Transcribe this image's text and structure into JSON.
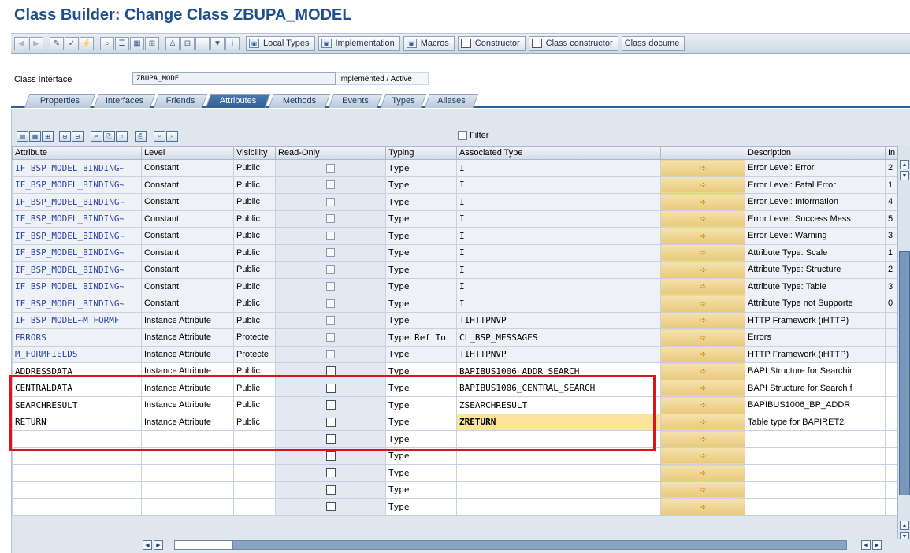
{
  "title": "Class Builder: Change Class ZBUPA_MODEL",
  "toolbar": {
    "buttons": [
      {
        "label": "Local Types",
        "icon": "local-types-icon"
      },
      {
        "label": "Implementation",
        "icon": "implementation-icon"
      },
      {
        "label": "Macros",
        "icon": "macros-icon"
      },
      {
        "label": "Constructor",
        "icon": "page-icon"
      },
      {
        "label": "Class constructor",
        "icon": "page-icon"
      },
      {
        "label": "Class docume",
        "icon": ""
      }
    ]
  },
  "interface": {
    "label": "Class Interface",
    "value": "ZBUPA_MODEL",
    "status": "Implemented / Active"
  },
  "tabs": [
    "Properties",
    "Interfaces",
    "Friends",
    "Attributes",
    "Methods",
    "Events",
    "Types",
    "Aliases"
  ],
  "active_tab": "Attributes",
  "filter_label": "Filter",
  "columns": [
    "Attribute",
    "Level",
    "Visibility",
    "Read-Only",
    "Typing",
    "Associated Type",
    "",
    "Description",
    "In"
  ],
  "rows": [
    {
      "attribute": "IF_BSP_MODEL_BINDING~",
      "level": "Constant",
      "visibility": "Public",
      "typing": "Type",
      "assoc": "I",
      "description": "Error Level: Error",
      "initial": "2"
    },
    {
      "attribute": "IF_BSP_MODEL_BINDING~",
      "level": "Constant",
      "visibility": "Public",
      "typing": "Type",
      "assoc": "I",
      "description": "Error Level: Fatal Error",
      "initial": "1"
    },
    {
      "attribute": "IF_BSP_MODEL_BINDING~",
      "level": "Constant",
      "visibility": "Public",
      "typing": "Type",
      "assoc": "I",
      "description": "Error Level: Information",
      "initial": "4"
    },
    {
      "attribute": "IF_BSP_MODEL_BINDING~",
      "level": "Constant",
      "visibility": "Public",
      "typing": "Type",
      "assoc": "I",
      "description": "Error Level: Success Mess",
      "initial": "5"
    },
    {
      "attribute": "IF_BSP_MODEL_BINDING~",
      "level": "Constant",
      "visibility": "Public",
      "typing": "Type",
      "assoc": "I",
      "description": "Error Level: Warning",
      "initial": "3"
    },
    {
      "attribute": "IF_BSP_MODEL_BINDING~",
      "level": "Constant",
      "visibility": "Public",
      "typing": "Type",
      "assoc": "I",
      "description": "Attribute Type: Scale",
      "initial": "1"
    },
    {
      "attribute": "IF_BSP_MODEL_BINDING~",
      "level": "Constant",
      "visibility": "Public",
      "typing": "Type",
      "assoc": "I",
      "description": "Attribute Type: Structure",
      "initial": "2"
    },
    {
      "attribute": "IF_BSP_MODEL_BINDING~",
      "level": "Constant",
      "visibility": "Public",
      "typing": "Type",
      "assoc": "I",
      "description": "Attribute Type: Table",
      "initial": "3"
    },
    {
      "attribute": "IF_BSP_MODEL_BINDING~",
      "level": "Constant",
      "visibility": "Public",
      "typing": "Type",
      "assoc": "I",
      "description": "Attribute Type not Supporte",
      "initial": "0"
    },
    {
      "attribute": "IF_BSP_MODEL~M_FORMF",
      "level": "Instance Attribute",
      "visibility": "Public",
      "typing": "Type",
      "assoc": "TIHTTPNVP",
      "description": "HTTP Framework (iHTTP)",
      "initial": ""
    },
    {
      "attribute": "ERRORS",
      "level": "Instance Attribute",
      "visibility": "Protecte",
      "typing": "Type Ref To",
      "assoc": "CL_BSP_MESSAGES",
      "description": "Errors",
      "initial": ""
    },
    {
      "attribute": "M_FORMFIELDS",
      "level": "Instance Attribute",
      "visibility": "Protecte",
      "typing": "Type",
      "assoc": "TIHTTPNVP",
      "description": "HTTP Framework (iHTTP)",
      "initial": ""
    },
    {
      "attribute": "ADDRESSDATA",
      "level": "Instance Attribute",
      "visibility": "Public",
      "typing": "Type",
      "assoc": "BAPIBUS1006_ADDR_SEARCH",
      "description": "BAPI Structure for Searchir",
      "initial": ""
    },
    {
      "attribute": "CENTRALDATA",
      "level": "Instance Attribute",
      "visibility": "Public",
      "typing": "Type",
      "assoc": "BAPIBUS1006_CENTRAL_SEARCH",
      "description": "BAPI Structure for Search f",
      "initial": ""
    },
    {
      "attribute": "SEARCHRESULT",
      "level": "Instance Attribute",
      "visibility": "Public",
      "typing": "Type",
      "assoc": "ZSEARCHRESULT",
      "description": "BAPIBUS1006_BP_ADDR",
      "initial": ""
    },
    {
      "attribute": "RETURN",
      "level": "Instance Attribute",
      "visibility": "Public",
      "typing": "Type",
      "assoc": "ZRETURN",
      "description": "Table type for BAPIRET2",
      "initial": ""
    },
    {
      "attribute": "",
      "level": "",
      "visibility": "",
      "typing": "Type",
      "assoc": "",
      "description": "",
      "initial": ""
    },
    {
      "attribute": "",
      "level": "",
      "visibility": "",
      "typing": "Type",
      "assoc": "",
      "description": "",
      "initial": ""
    },
    {
      "attribute": "",
      "level": "",
      "visibility": "",
      "typing": "Type",
      "assoc": "",
      "description": "",
      "initial": ""
    },
    {
      "attribute": "",
      "level": "",
      "visibility": "",
      "typing": "Type",
      "assoc": "",
      "description": "",
      "initial": ""
    },
    {
      "attribute": "",
      "level": "",
      "visibility": "",
      "typing": "Type",
      "assoc": "",
      "description": "",
      "initial": ""
    }
  ],
  "colors": {
    "title": "#1f4e8c",
    "active_tab": "#2f5f96",
    "highlight_box": "#d9171a",
    "arrow_button": "#e9c97a"
  }
}
